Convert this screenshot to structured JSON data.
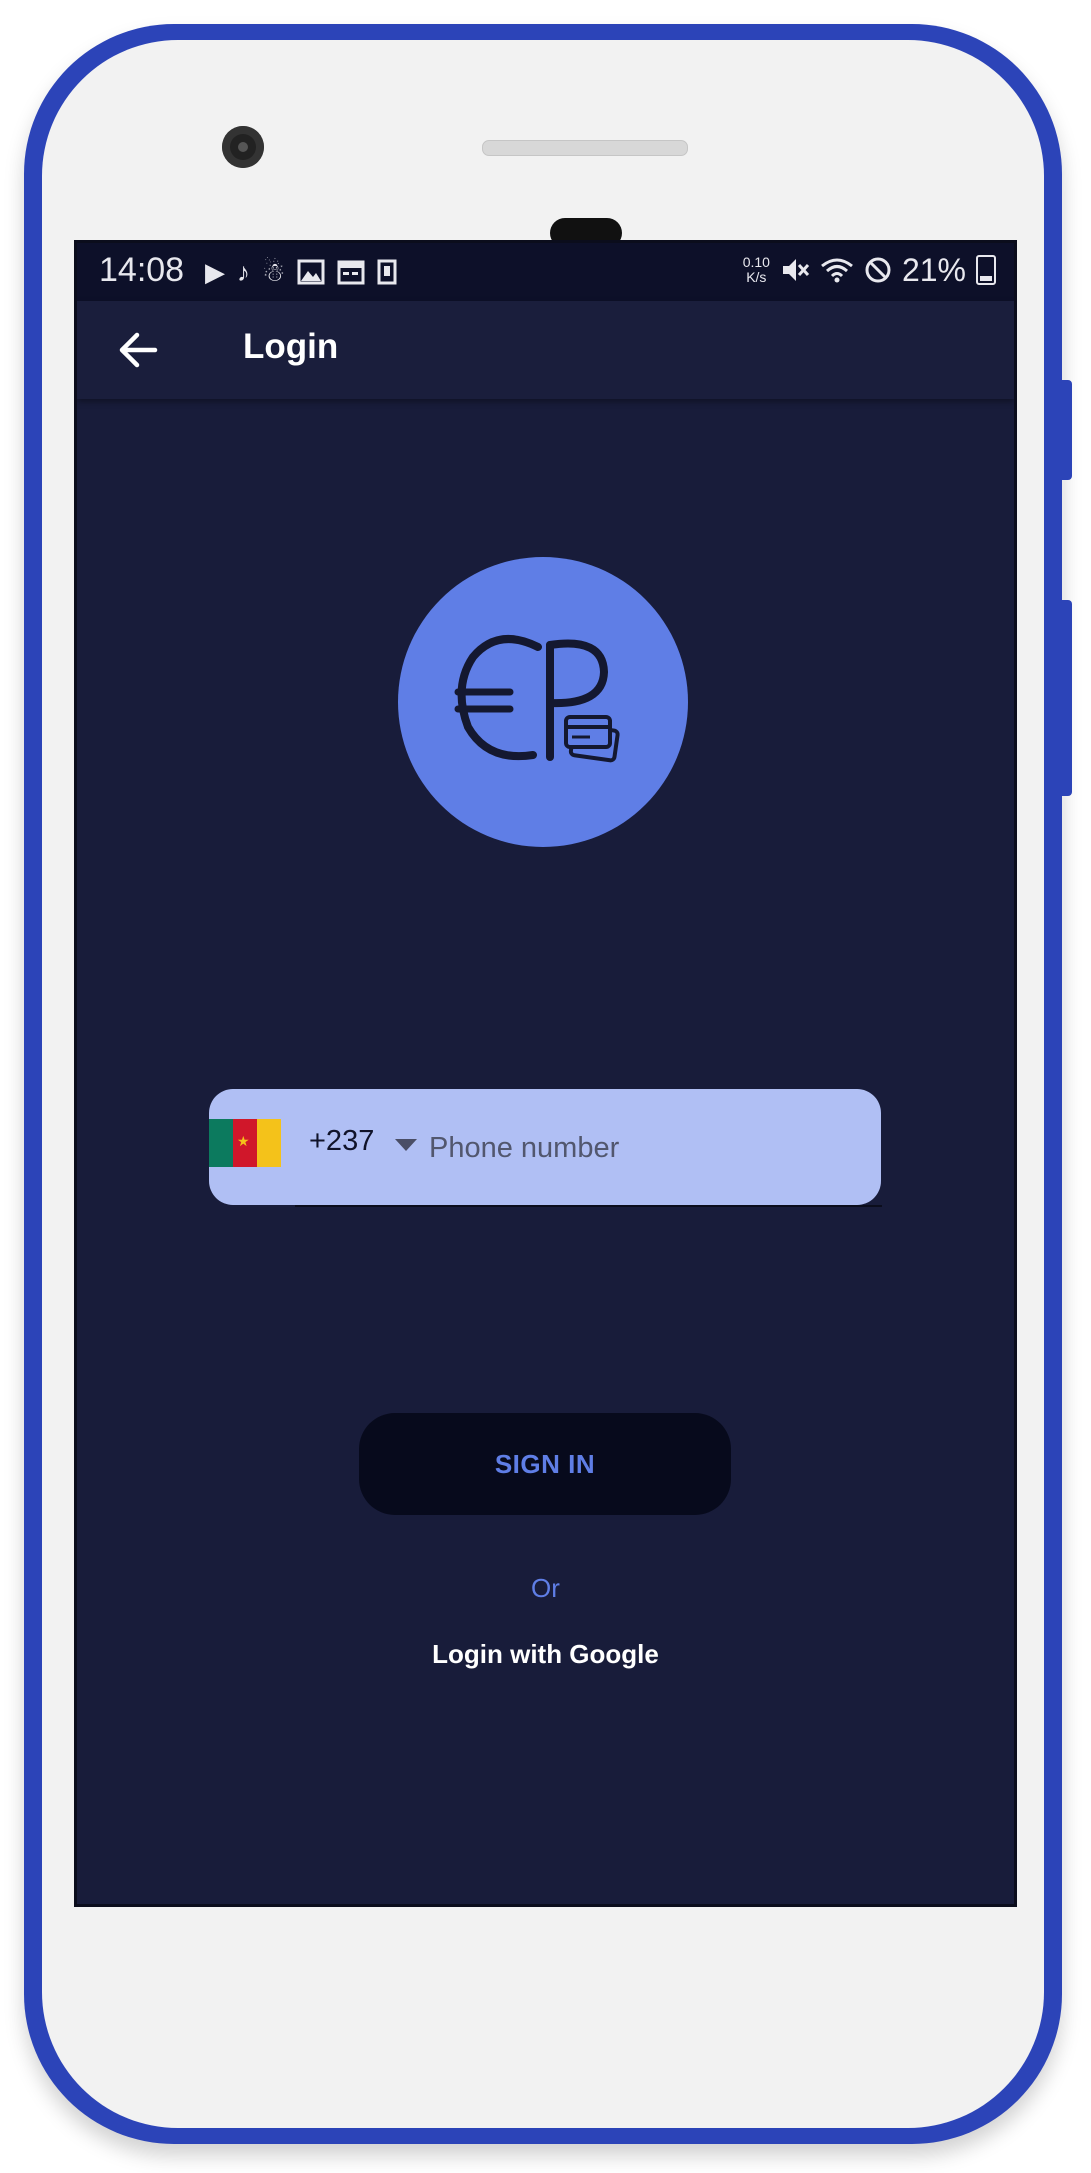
{
  "status_bar": {
    "time": "14:08",
    "left_icons": [
      "play-icon",
      "music-note-icon",
      "notification-icon",
      "image-icon",
      "calendar-icon",
      "phone-frame-icon"
    ],
    "net_speed": "0.10 K/s",
    "net_speed_value": "0.10",
    "net_speed_unit": "K/s",
    "right_icons": [
      "mute-icon",
      "wifi-icon",
      "do-not-disturb-icon"
    ],
    "battery_percent": "21%"
  },
  "app_bar": {
    "title": "Login",
    "back_icon": "arrow-back-icon"
  },
  "logo": {
    "name": "ep-logo",
    "text": "EP",
    "color": "#5f7ee6"
  },
  "phone_form": {
    "country_flag": "cameroon-flag",
    "dial_code": "+237",
    "placeholder": "Phone number",
    "value": ""
  },
  "actions": {
    "sign_in_label": "SIGN IN",
    "or_label": "Or",
    "google_label": "Login with Google"
  },
  "colors": {
    "background": "#181c3a",
    "status_bar": "#0d1029",
    "accent": "#5f7ee6",
    "input_bg": "#b0bff4",
    "button_bg": "#070a1c",
    "device_frame": "#2c44b8"
  }
}
